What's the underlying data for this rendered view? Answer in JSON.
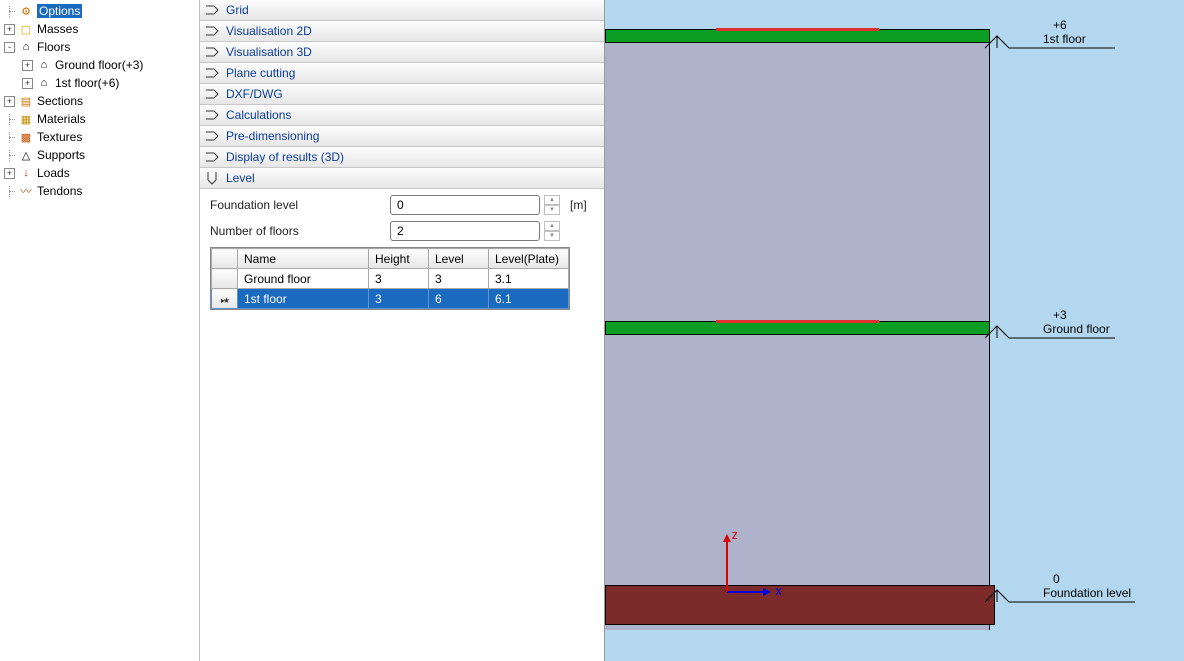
{
  "tree": {
    "options": "Options",
    "masses": "Masses",
    "floors": "Floors",
    "ground_floor": "Ground floor(+3)",
    "first_floor": "1st floor(+6)",
    "sections": "Sections",
    "materials": "Materials",
    "textures": "Textures",
    "supports": "Supports",
    "loads": "Loads",
    "tendons": "Tendons"
  },
  "panels": {
    "grid": "Grid",
    "vis2d": "Visualisation 2D",
    "vis3d": "Visualisation 3D",
    "plane": "Plane cutting",
    "dxf": "DXF/DWG",
    "calc": "Calculations",
    "predim": "Pre-dimensioning",
    "results3d": "Display of results (3D)",
    "level": "Level"
  },
  "level_form": {
    "foundation_label": "Foundation level",
    "foundation_value": "0",
    "unit": "[m]",
    "nfloors_label": "Number of floors",
    "nfloors_value": "2"
  },
  "level_table": {
    "headers": {
      "name": "Name",
      "height": "Height",
      "level": "Level",
      "level_plate": "Level(Plate)"
    },
    "rows": [
      {
        "name": "Ground floor",
        "height": "3",
        "level": "3",
        "plate": "3.1",
        "selected": false
      },
      {
        "name": "1st floor",
        "height": "3",
        "level": "6",
        "plate": "6.1",
        "selected": true
      }
    ]
  },
  "viewport": {
    "axis_x": "x",
    "axis_z": "z",
    "marks": [
      {
        "value": "+6",
        "name": "1st floor"
      },
      {
        "value": "+3",
        "name": "Ground floor"
      },
      {
        "value": "0",
        "name": "Foundation level"
      }
    ]
  }
}
